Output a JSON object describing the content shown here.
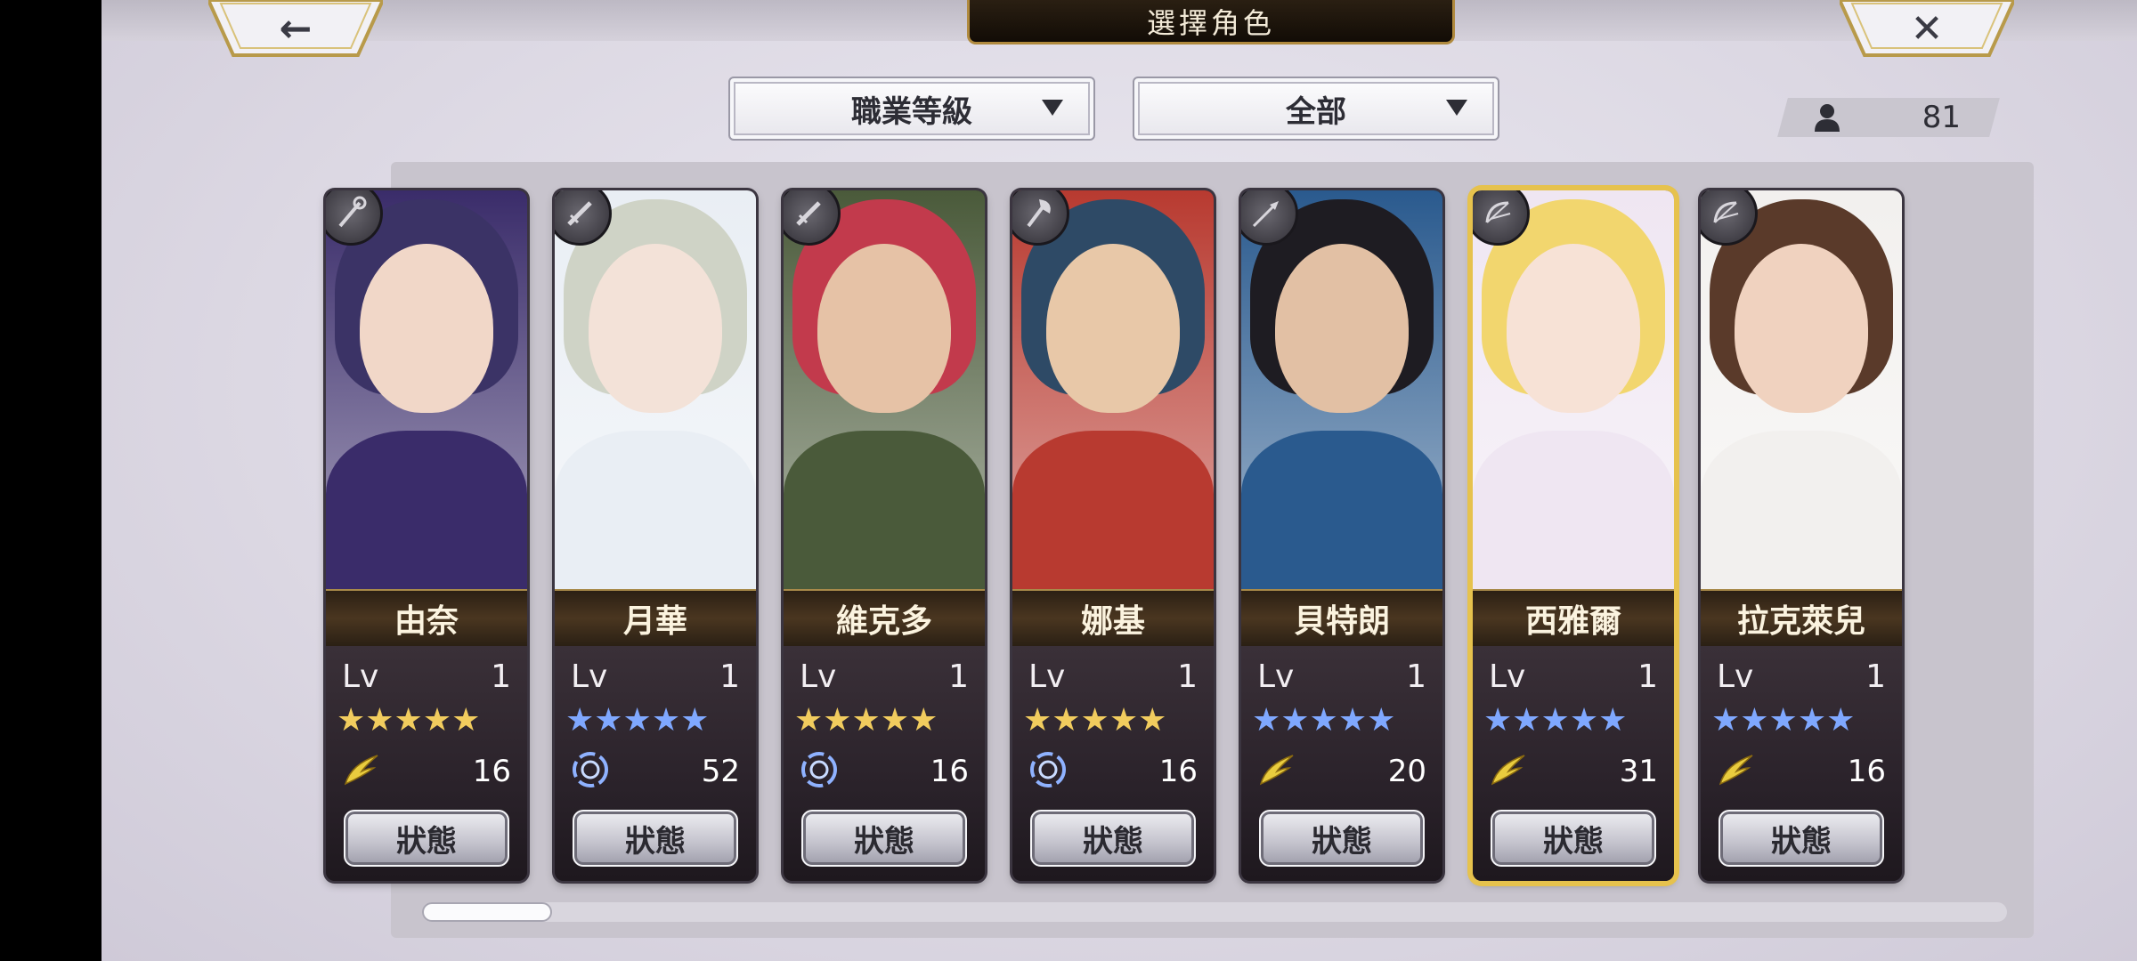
{
  "header": {
    "title": "選擇角色",
    "back_glyph": "←",
    "close_glyph": "✕"
  },
  "filters": {
    "class_label": "職業等級",
    "scope_label": "全部"
  },
  "roster_count": "81",
  "colors": {
    "gold_accent": "#e6c24d",
    "name_bar": "#3a2a18",
    "card_dark": "#2a222a"
  },
  "characters": [
    {
      "name": "由奈",
      "lv_label": "Lv",
      "level": "1",
      "stars": "★★★★★",
      "star_color": "gold",
      "element": "wind-wing-icon",
      "cost": "16",
      "status": "狀態",
      "weapon": "staff-icon",
      "palette": [
        "#3b3366",
        "#f1d7c8",
        "#3a2c6a"
      ]
    },
    {
      "name": "月華",
      "lv_label": "Lv",
      "level": "1",
      "stars": "★★★★★",
      "star_color": "blue",
      "element": "spiral-icon",
      "cost": "52",
      "status": "狀態",
      "weapon": "sword-icon",
      "palette": [
        "#cfd3c6",
        "#f3e2d8",
        "#e9eef4"
      ]
    },
    {
      "name": "維克多",
      "lv_label": "Lv",
      "level": "1",
      "stars": "★★★★★",
      "star_color": "gold",
      "element": "spiral-icon",
      "cost": "16",
      "status": "狀態",
      "weapon": "sword-icon",
      "palette": [
        "#c23a4c",
        "#e6c2a6",
        "#4a5a3a"
      ]
    },
    {
      "name": "娜基",
      "lv_label": "Lv",
      "level": "1",
      "stars": "★★★★★",
      "star_color": "gold",
      "element": "spiral-icon",
      "cost": "16",
      "status": "狀態",
      "weapon": "axe-icon",
      "palette": [
        "#2e4a66",
        "#e8c8a8",
        "#b83a30"
      ]
    },
    {
      "name": "貝特朗",
      "lv_label": "Lv",
      "level": "1",
      "stars": "★★★★★",
      "star_color": "blue",
      "element": "wind-wing-icon",
      "cost": "20",
      "status": "狀態",
      "weapon": "spear-icon",
      "palette": [
        "#1e1c22",
        "#e2c0a4",
        "#2a5a8e"
      ]
    },
    {
      "name": "西雅爾",
      "lv_label": "Lv",
      "level": "1",
      "stars": "★★★★★",
      "star_color": "blue",
      "element": "wind-wing-icon",
      "cost": "31",
      "status": "狀態",
      "weapon": "bow-icon",
      "palette": [
        "#f2d66e",
        "#f7e2d6",
        "#efe6f2"
      ]
    },
    {
      "name": "拉克萊兒",
      "lv_label": "Lv",
      "level": "1",
      "stars": "★★★★★",
      "star_color": "blue",
      "element": "wind-wing-icon",
      "cost": "16",
      "status": "狀態",
      "weapon": "bow-icon",
      "palette": [
        "#5a3a2a",
        "#f0d2bf",
        "#f2f0ee"
      ]
    }
  ]
}
